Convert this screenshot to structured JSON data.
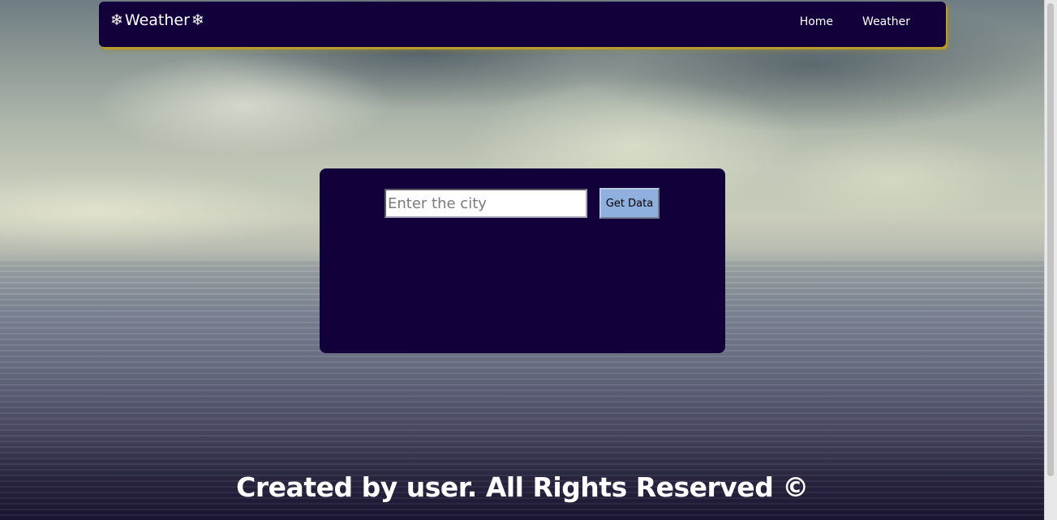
{
  "navbar": {
    "brand": "Weather",
    "brand_icon": "snowflake-icon",
    "links": [
      {
        "label": "Home"
      },
      {
        "label": "Weather"
      }
    ]
  },
  "search": {
    "placeholder": "Enter the city",
    "value": "",
    "button_label": "Get Data"
  },
  "footer": {
    "text": "Created by user. All Rights Reserved ©"
  },
  "colors": {
    "navbar_bg": "#12003a",
    "panel_bg": "#12003a",
    "navbar_shadow": "#b99b2a",
    "button_bg": "#8fb0de",
    "text": "#ffffff"
  }
}
